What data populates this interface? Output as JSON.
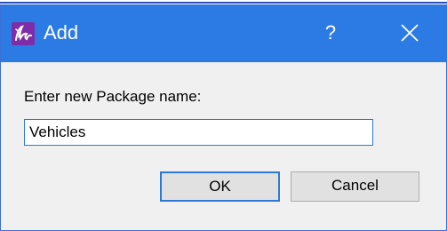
{
  "window": {
    "title": "Add",
    "help_glyph": "?",
    "app_icon": "app-logo-icon",
    "close_icon": "close-icon",
    "titlebar_color": "#2c7be5"
  },
  "form": {
    "prompt": "Enter new Package name:",
    "name_value": "Vehicles"
  },
  "buttons": {
    "ok_label": "OK",
    "cancel_label": "Cancel"
  }
}
